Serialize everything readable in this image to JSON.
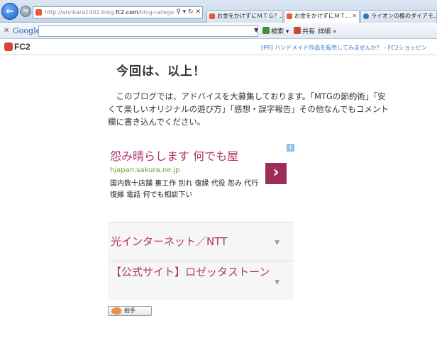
{
  "browser": {
    "address": "http://annkara1402.blog.fc2.com/blog-category-2.",
    "address_domain_part": "fc2.com",
    "address_prefix": "http://annkara1402.blog.",
    "address_suffix": "/blog-category-2.",
    "tabs": [
      {
        "label": "お金をかけずにＭＴＧ？...",
        "active": false
      },
      {
        "label": "お金をかけずにＭＴ...",
        "active": true
      },
      {
        "label": "ライオンの檻のダイアモ...",
        "active": false
      }
    ]
  },
  "google_toolbar": {
    "logo": "Google",
    "search_label": "検索",
    "share_label": "共有",
    "more_label": "詳細"
  },
  "fc2_bar": {
    "logo": "FC2",
    "pr_text": "[PR] ハンドメイド作品を販売してみませんか？ - FC2ショッピン"
  },
  "content": {
    "heading": "今回は、以上！",
    "paragraph": "　このブログでは、アドバイスを大募集しております。「MTGの節約術」「安くて楽しいオリジナルの遊び方」「感想・誤字報告」その他なんでもコメント欄に書き込んでください。"
  },
  "ad": {
    "title": "怨み晴らします 何でも屋",
    "url": "hjapan.sakura.ne.jp",
    "description": "国内数十店舗 裏工作 別れ 復縁 代役 怨み 代行 復縁 電話 何でも相談下い",
    "info_icon": "i"
  },
  "ad_links": [
    {
      "label": "光インターネット／NTT"
    },
    {
      "label": "【公式サイト】ロゼッタストーン"
    }
  ],
  "clap_button": {
    "label": "拍手"
  },
  "colors": {
    "ad_accent": "#b0356e",
    "ad_url": "#6aa03a",
    "ad_arrow_bg": "#9c2d59",
    "pr_link": "#3a78c2"
  }
}
